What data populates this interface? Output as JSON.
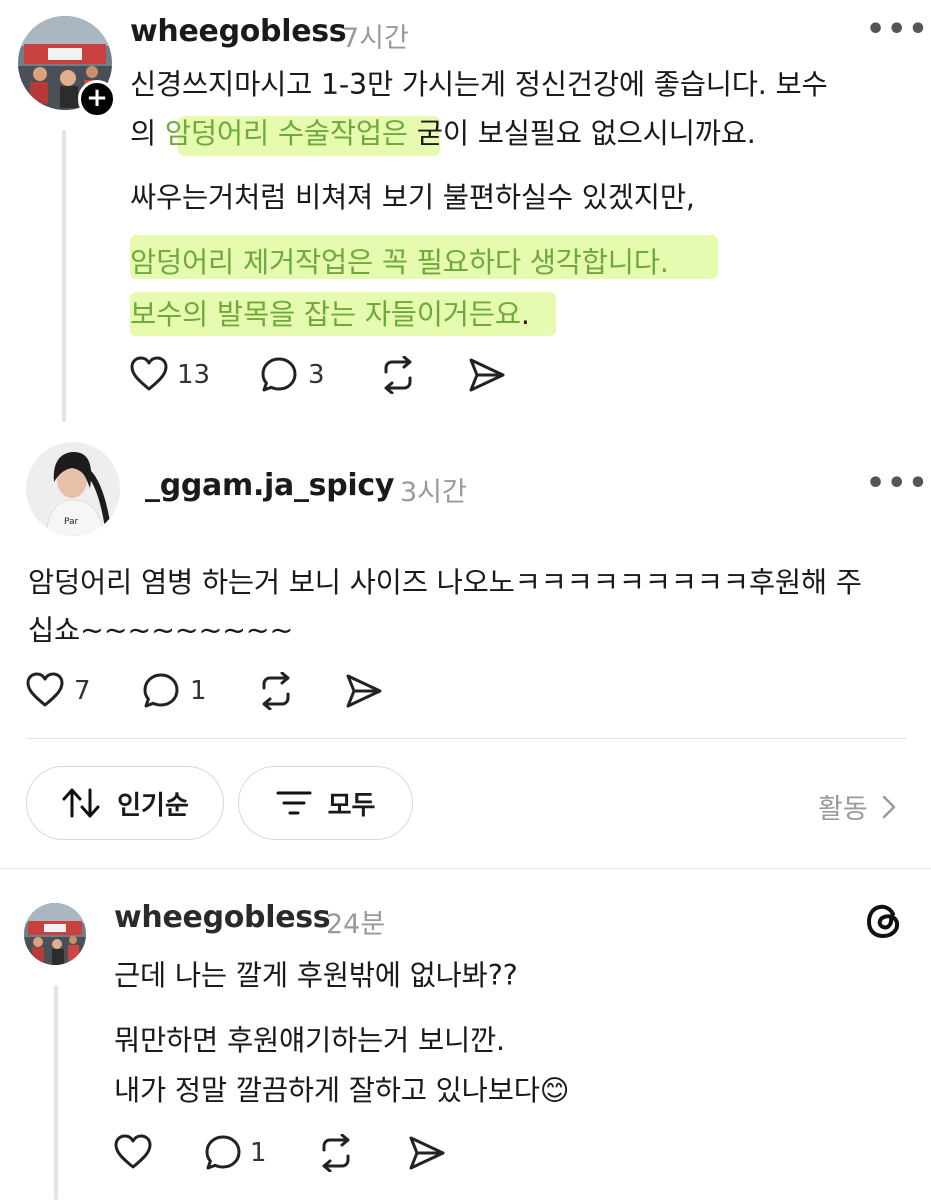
{
  "comments": [
    {
      "username": "wheegobless",
      "time": "7시간",
      "lines": [
        {
          "pre": "신경쓰지마시고 1-3만 가시는게 정신건강에 좋습니다. 보수",
          "hl": "",
          "post": ""
        },
        {
          "pre": "의 ",
          "hl": "암덩어리 수술작업은",
          "post": " 굳이 보실필요 없으시니까요."
        },
        {
          "pre": "싸우는거처럼 비쳐져 보기 불편하실수 있겠지만,",
          "hl": "",
          "post": ""
        },
        {
          "pre": "",
          "hl": "암덩어리 제거작업은 꼭 필요하다 생각합니다.",
          "post": ""
        },
        {
          "pre": "",
          "hl": "보수의 발목을 잡는 자들이거든요",
          "post": "."
        }
      ],
      "likes": "13",
      "replies": "3"
    },
    {
      "username": "_ggam.ja_spicy",
      "time": "3시간",
      "lines": [
        "암덩어리 염병 하는거 보니 사이즈 나오노ㅋㅋㅋㅋㅋㅋㅋㅋㅋ후원해 주",
        "십쇼~~~~~~~~~"
      ],
      "likes": "7",
      "replies": "1"
    },
    {
      "username": "wheegobless",
      "time": "24분",
      "lines": [
        "근데 나는 깔게 후원밖에 없나봐??",
        "뭐만하면 후원얘기하는거 보니깐.",
        "내가 정말 깔끔하게 잘하고 있나보다",
        "😊"
      ],
      "likes": "",
      "replies": "1"
    }
  ],
  "filters": {
    "sort_label": "인기순",
    "filter_label": "모두",
    "activity_label": "활동"
  },
  "icons": {
    "like": "heart-icon",
    "reply": "comment-icon",
    "repost": "repost-icon",
    "share": "send-icon",
    "more": "more-icon",
    "sort": "sort-arrows-icon",
    "filter": "filter-lines-icon",
    "threads": "threads-logo-icon"
  },
  "colors": {
    "highlight": "#e6fbb0",
    "highlight_text": "#6eaa3b",
    "muted": "#9a9a9a"
  }
}
